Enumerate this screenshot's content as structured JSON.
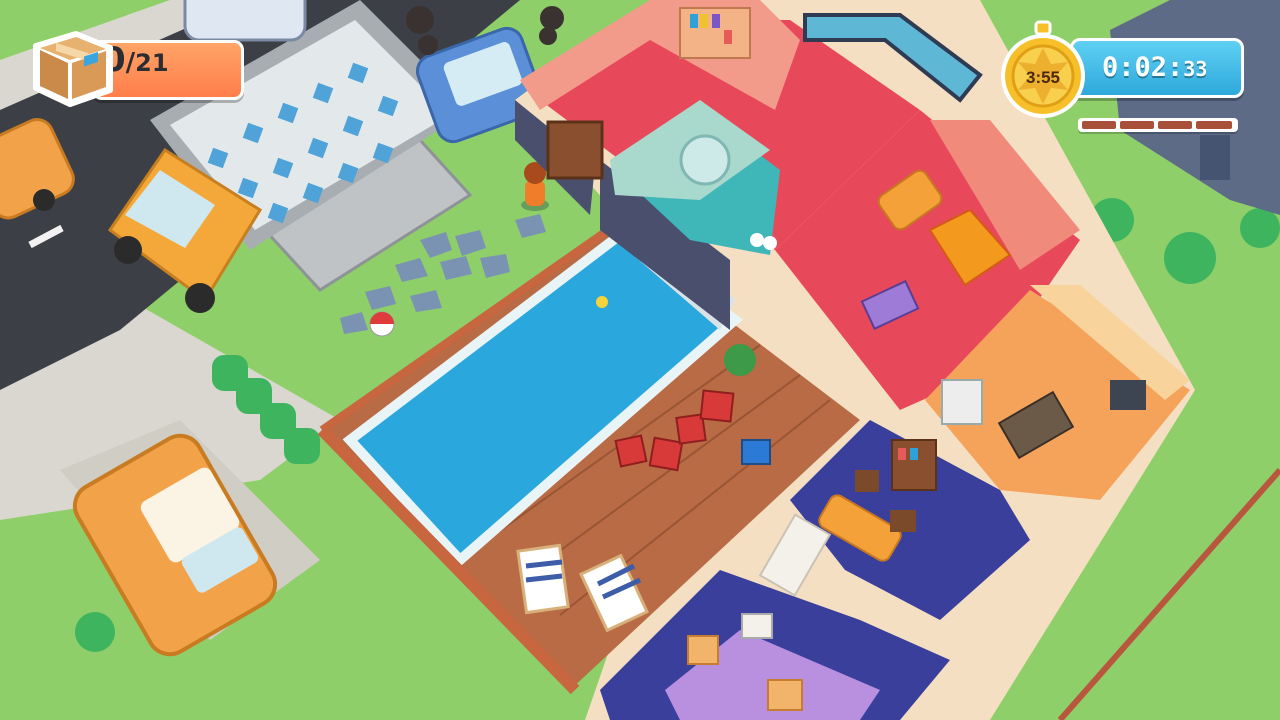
{
  "hud": {
    "box_counter": {
      "current": "0",
      "separator": "/",
      "total": "21",
      "icon": "cardboard-box-icon"
    },
    "timer": {
      "medal_target_time": "3:55",
      "medal_icon": "gold-stopwatch-medal-icon",
      "elapsed_main": "0:02:",
      "elapsed_fraction": "33",
      "segments_remaining": 4
    }
  },
  "colors": {
    "counter_orange": "#ff8a4f",
    "timer_blue": "#3bb6e4",
    "medal_gold": "#f7c02b",
    "grass": "#8fcf6a",
    "road": "#3d3f46",
    "pool_water": "#2aa7dd",
    "deck_wood": "#b86b45",
    "kitchen_floor": "#f5a35a",
    "living_floor": "#e8495a",
    "bedroom_floor": "#3a3f9c",
    "bathroom_floor": "#3fb7b9"
  }
}
